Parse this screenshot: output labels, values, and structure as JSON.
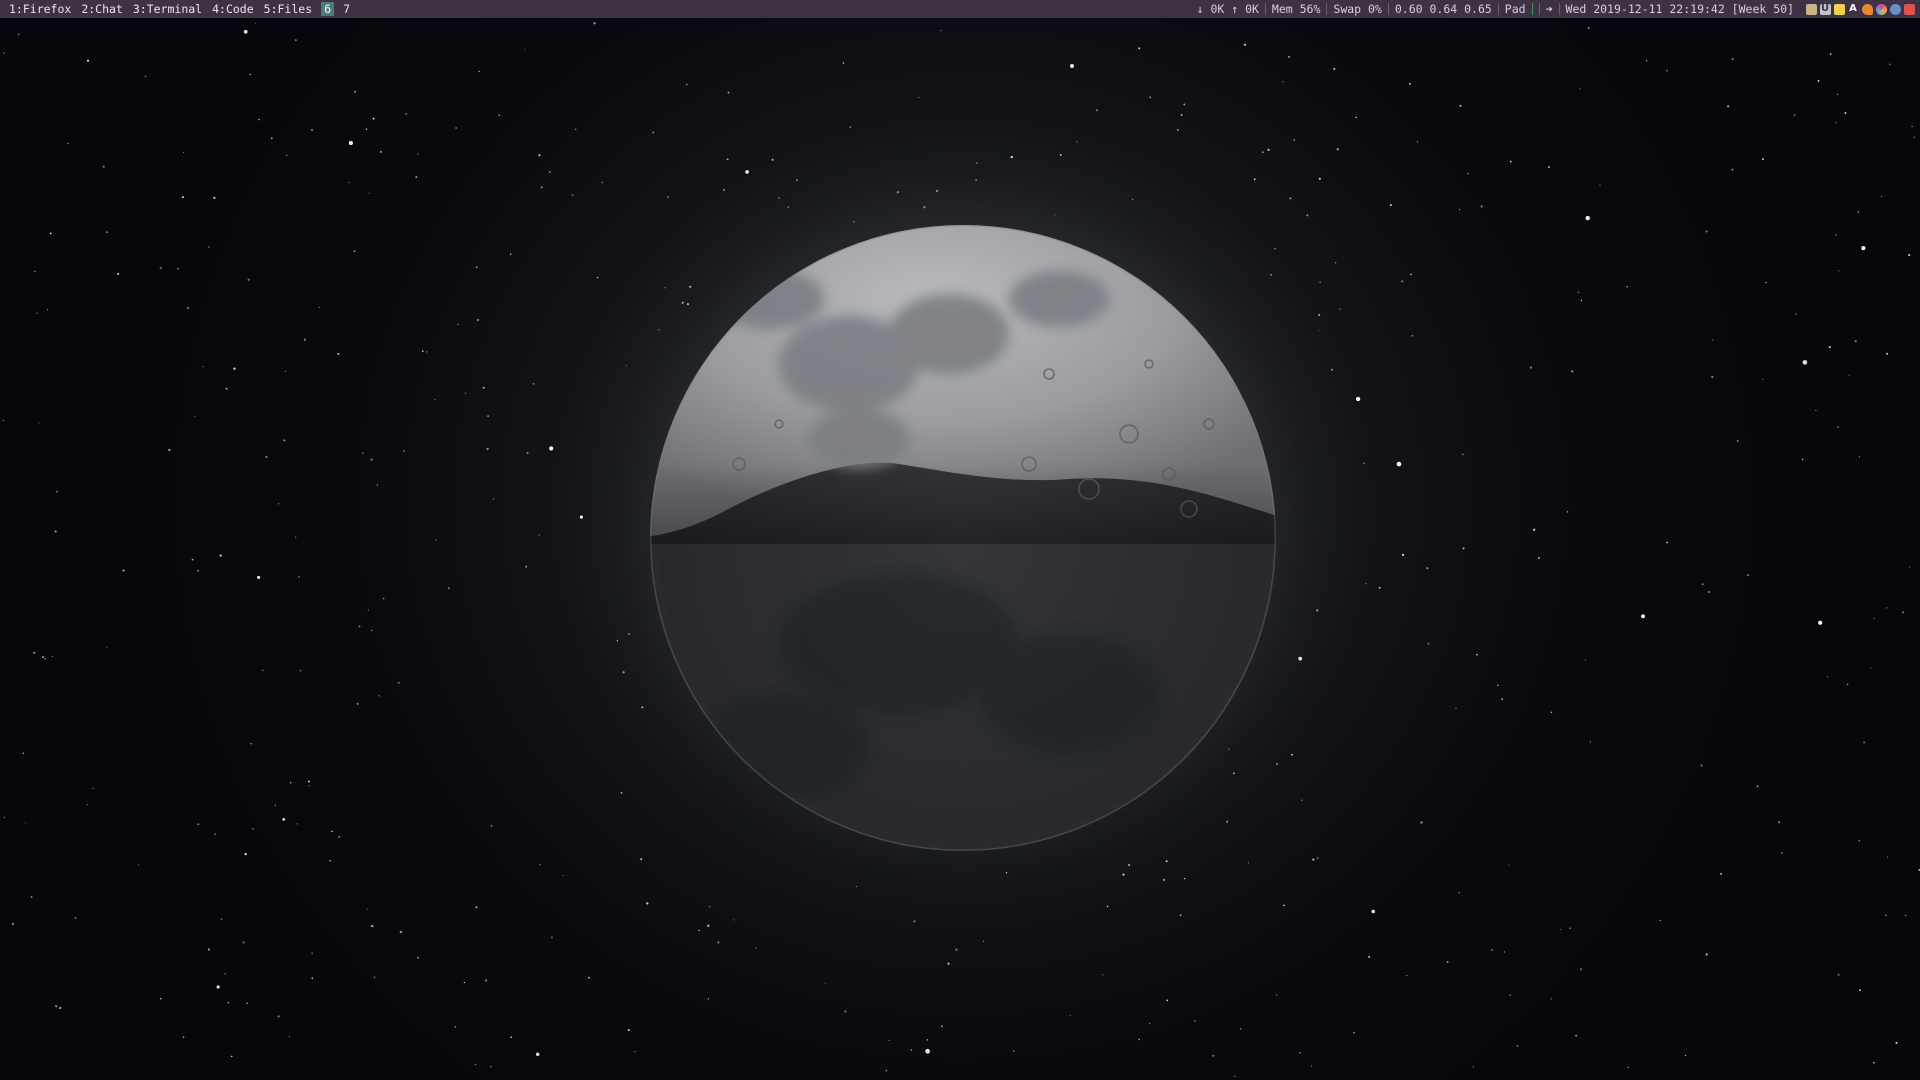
{
  "workspaces": [
    {
      "label": "1:Firefox",
      "active": false
    },
    {
      "label": "2:Chat",
      "active": false
    },
    {
      "label": "3:Terminal",
      "active": false
    },
    {
      "label": "4:Code",
      "active": false
    },
    {
      "label": "5:Files",
      "active": false
    },
    {
      "label": "6",
      "active": true
    },
    {
      "label": "7",
      "active": false
    }
  ],
  "status": {
    "network": "↓ 0K ↑ 0K",
    "mem": "Mem 56%",
    "swap": "Swap 0%",
    "load": "0.60 0.64 0.65",
    "pad": "Pad",
    "arrow": "➜",
    "datetime": "Wed 2019-12-11 22:19:42 [Week 50]"
  },
  "tray": [
    {
      "icon": "clipboard-icon",
      "color": "#c9b486",
      "glyph": ""
    },
    {
      "icon": "magnet-icon",
      "color": "#bfc3cc",
      "glyph": "U"
    },
    {
      "icon": "note-icon",
      "color": "#f2d14c",
      "glyph": ""
    },
    {
      "icon": "font-a-icon",
      "color": "#3e3247",
      "glyph": "A"
    },
    {
      "icon": "flame-icon",
      "color": "#e8872b",
      "glyph": ""
    },
    {
      "icon": "pinwheel-icon",
      "color": "#d9409a",
      "glyph": ""
    },
    {
      "icon": "network-globe-icon",
      "color": "#6a8fc7",
      "glyph": ""
    },
    {
      "icon": "mail-icon",
      "color": "#d9534f",
      "glyph": ""
    }
  ],
  "colors": {
    "bar_background": "#3e3247",
    "active_workspace": "#4d7a7d",
    "sky": "#05070d"
  }
}
